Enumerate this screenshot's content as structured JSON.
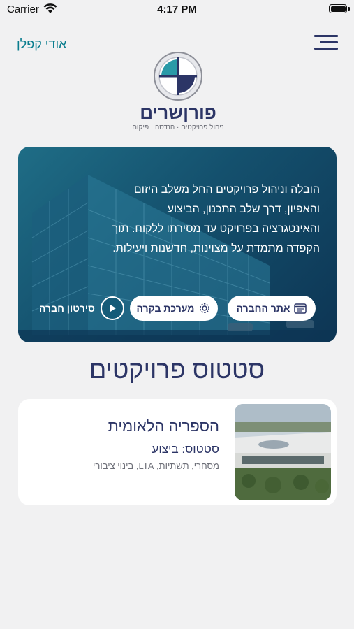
{
  "status_bar": {
    "carrier": "Carrier",
    "time": "4:17 PM"
  },
  "header": {
    "user_name": "אודי קפלן",
    "menu_icon": "hamburger-menu-icon"
  },
  "logo": {
    "brand_name": "פורןשרים",
    "tagline": "ניהול פרויקטים · הנדסה · פיקוח"
  },
  "hero": {
    "description": "הובלה וניהול פרויקטים החל משלב היזום והאפיון, דרך שלב התכנון, הביצוע והאינטגרציה בפרויקט עד מסירתו ללקוח. תוך הקפדה מתמדת על מצוינות, חדשנות ויעילות.",
    "buttons": {
      "website": {
        "label": "אתר החברה",
        "icon": "browser-icon"
      },
      "control": {
        "label": "מערכת בקרה",
        "icon": "gear-icon"
      },
      "video": {
        "label": "סירטון חברה",
        "icon": "play-icon"
      }
    }
  },
  "section": {
    "title": "סטטוס פרויקטים"
  },
  "projects": [
    {
      "name": "הספריה הלאומית",
      "status": "סטטוס: ביצוע",
      "tags": "מסחרי, תשתיות, LTA, בינוי ציבורי"
    }
  ],
  "colors": {
    "primary": "#2c3566",
    "accent": "#0a7d8e",
    "background": "#f1f1f2",
    "hero": "#14506d"
  }
}
